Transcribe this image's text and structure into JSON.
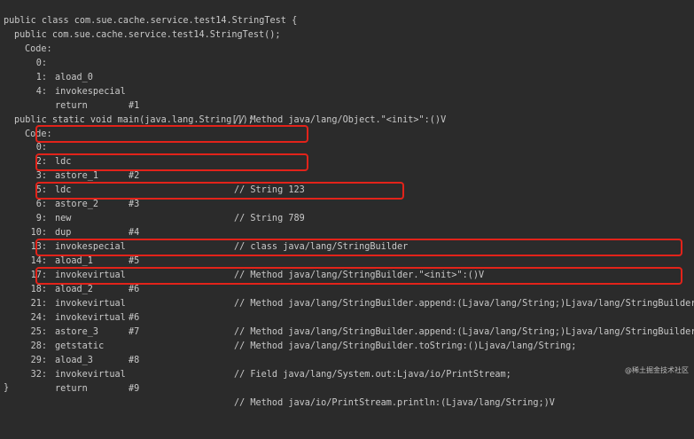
{
  "header": {
    "class_decl": "public class com.sue.cache.service.test14.StringTest {",
    "ctor_decl": "public com.sue.cache.service.test14.StringTest();",
    "code_label": "Code:"
  },
  "ctor_code": [
    {
      "offset": "0:",
      "op": "aload_0",
      "arg": "",
      "comment": ""
    },
    {
      "offset": "1:",
      "op": "invokespecial",
      "arg": "#1",
      "comment": "// Method java/lang/Object.\"<init>\":()V"
    },
    {
      "offset": "4:",
      "op": "return",
      "arg": "",
      "comment": ""
    }
  ],
  "main": {
    "decl": "public static void main(java.lang.String[]);",
    "code_label": "Code:"
  },
  "main_code": [
    {
      "offset": "0:",
      "op": "ldc",
      "arg": "#2",
      "comment": "// String 123"
    },
    {
      "offset": "2:",
      "op": "astore_1",
      "arg": "",
      "comment": ""
    },
    {
      "offset": "3:",
      "op": "ldc",
      "arg": "#3",
      "comment": "// String 789"
    },
    {
      "offset": "5:",
      "op": "astore_2",
      "arg": "",
      "comment": ""
    },
    {
      "offset": "6:",
      "op": "new",
      "arg": "#4",
      "comment": "// class java/lang/StringBuilder"
    },
    {
      "offset": "9:",
      "op": "dup",
      "arg": "",
      "comment": ""
    },
    {
      "offset": "10:",
      "op": "invokespecial",
      "arg": "#5",
      "comment": "// Method java/lang/StringBuilder.\"<init>\":()V"
    },
    {
      "offset": "13:",
      "op": "aload_1",
      "arg": "",
      "comment": ""
    },
    {
      "offset": "14:",
      "op": "invokevirtual",
      "arg": "#6",
      "comment": "// Method java/lang/StringBuilder.append:(Ljava/lang/String;)Ljava/lang/StringBuilder"
    },
    {
      "offset": "17:",
      "op": "aload_2",
      "arg": "",
      "comment": ""
    },
    {
      "offset": "18:",
      "op": "invokevirtual",
      "arg": "#6",
      "comment": "// Method java/lang/StringBuilder.append:(Ljava/lang/String;)Ljava/lang/StringBuilder"
    },
    {
      "offset": "21:",
      "op": "invokevirtual",
      "arg": "#7",
      "comment": "// Method java/lang/StringBuilder.toString:()Ljava/lang/String;"
    },
    {
      "offset": "24:",
      "op": "astore_3",
      "arg": "",
      "comment": ""
    },
    {
      "offset": "25:",
      "op": "getstatic",
      "arg": "#8",
      "comment": "// Field java/lang/System.out:Ljava/io/PrintStream;"
    },
    {
      "offset": "28:",
      "op": "aload_3",
      "arg": "",
      "comment": ""
    },
    {
      "offset": "29:",
      "op": "invokevirtual",
      "arg": "#9",
      "comment": "// Method java/io/PrintStream.println:(Ljava/lang/String;)V"
    },
    {
      "offset": "32:",
      "op": "return",
      "arg": "",
      "comment": ""
    }
  ],
  "closing_brace": "}",
  "watermark": "@稀土掘金技术社区",
  "colors": {
    "background": "#2b2b2b",
    "text": "#c9c9c9",
    "highlight": "#e2231a"
  }
}
